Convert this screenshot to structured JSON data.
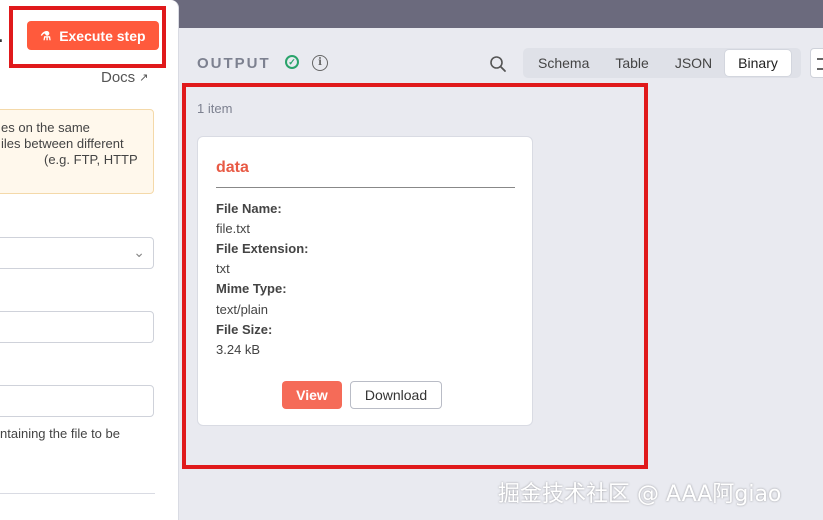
{
  "left_panel": {
    "title_fragment": ".",
    "execute_label": "Execute step",
    "docs_label": "Docs",
    "notice_lines": [
      "es on the same",
      "iles between different",
      "(e.g. FTP, HTTP"
    ],
    "hint_text": "ntaining the file to be"
  },
  "output": {
    "title": "OUTPUT",
    "tabs": [
      "Schema",
      "Table",
      "JSON",
      "Binary"
    ],
    "active_tab": "Binary",
    "item_count": "1 item",
    "card": {
      "title": "data",
      "fields": [
        {
          "label": "File Name:",
          "value": "file.txt"
        },
        {
          "label": "File Extension:",
          "value": "txt"
        },
        {
          "label": "Mime Type:",
          "value": "text/plain"
        },
        {
          "label": "File Size:",
          "value": "3.24 kB"
        }
      ],
      "view_label": "View",
      "download_label": "Download"
    }
  },
  "watermark": "掘金技术社区 @ AAA阿giao",
  "colors": {
    "accent": "#ff5a3c",
    "highlight": "#e0191b",
    "success": "#2aa36b"
  }
}
